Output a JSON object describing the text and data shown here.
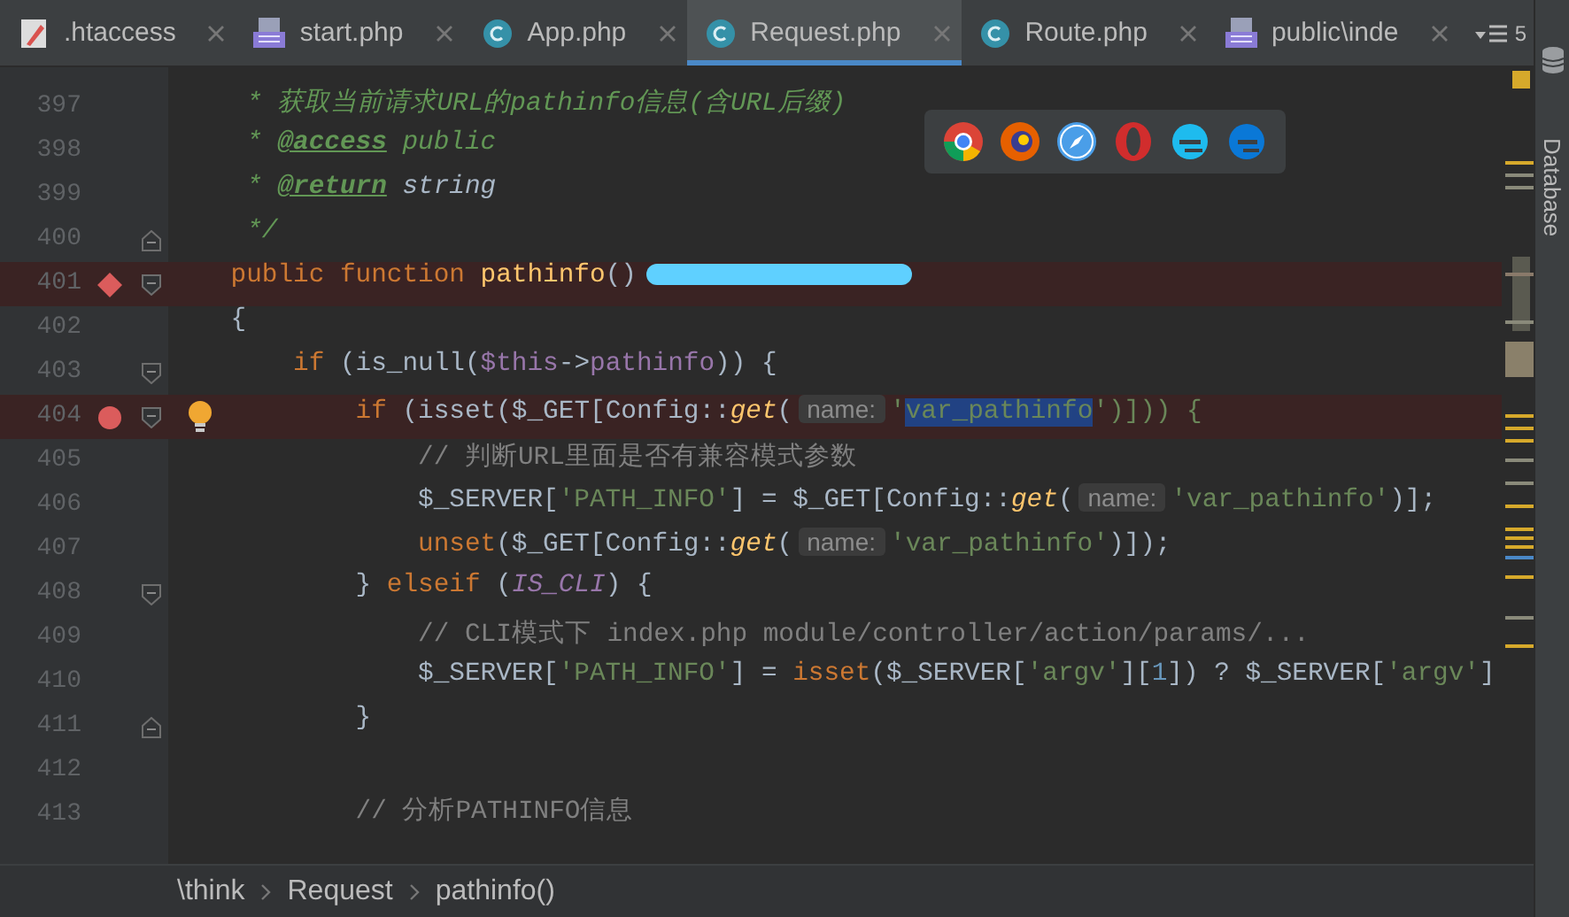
{
  "tabs": [
    {
      "label": ".htaccess",
      "kind": "htaccess",
      "selected": false
    },
    {
      "label": "start.php",
      "kind": "php",
      "selected": false
    },
    {
      "label": "App.php",
      "kind": "class",
      "selected": false
    },
    {
      "label": "Request.php",
      "kind": "class",
      "selected": true
    },
    {
      "label": "Route.php",
      "kind": "class",
      "selected": false
    },
    {
      "label": "public\\inde",
      "kind": "php",
      "selected": false
    }
  ],
  "tab_overflow": {
    "count": "5"
  },
  "side_panel": {
    "label": "Database"
  },
  "lines": [
    {
      "number": "397",
      "tokens": [
        {
          "text": "     * 获取当前请求URL的pathinfo信息(含URL后缀)",
          "kind": "doc"
        }
      ]
    },
    {
      "number": "398",
      "tokens": [
        {
          "text": "     * ",
          "kind": "doc"
        },
        {
          "text": "@access",
          "kind": "doctag"
        },
        {
          "text": " public",
          "kind": "doc"
        }
      ]
    },
    {
      "number": "399",
      "tokens": [
        {
          "text": "     * ",
          "kind": "doc"
        },
        {
          "text": "@return",
          "kind": "doctag"
        },
        {
          "text": " string",
          "kind": "doctype"
        }
      ]
    },
    {
      "number": "400",
      "fold_end": true,
      "tokens": [
        {
          "text": "     */",
          "kind": "doc"
        }
      ]
    },
    {
      "number": "401",
      "method_breakpoint": true,
      "fold_start": true,
      "highlighted": true,
      "redacted": true,
      "tokens": [
        {
          "text": "    public function ",
          "kind": "keyword"
        },
        {
          "text": "pathinfo",
          "kind": "function"
        },
        {
          "text": "()",
          "kind": "plain"
        }
      ]
    },
    {
      "number": "402",
      "tokens": [
        {
          "text": "    {",
          "kind": "plain"
        }
      ]
    },
    {
      "number": "403",
      "fold_start": true,
      "tokens": [
        {
          "text": "        if ",
          "kind": "keyword"
        },
        {
          "text": "(is_null(",
          "kind": "plain"
        },
        {
          "text": "$this",
          "kind": "variable"
        },
        {
          "text": "->",
          "kind": "plain"
        },
        {
          "text": "pathinfo",
          "kind": "variable"
        },
        {
          "text": ")) {",
          "kind": "plain"
        }
      ]
    },
    {
      "number": "404",
      "line_breakpoint": true,
      "fold_start": true,
      "bulb": true,
      "highlighted": true,
      "tokens": [
        {
          "text": "            if ",
          "kind": "keyword"
        },
        {
          "text": "(isset($_GET[Config::",
          "kind": "plain"
        },
        {
          "text": "get",
          "kind": "static"
        },
        {
          "text": "(",
          "kind": "plain"
        },
        {
          "text": "name:",
          "kind": "hint"
        },
        {
          "text": "'",
          "kind": "string"
        },
        {
          "text": "var_pathinfo",
          "kind": "selection"
        },
        {
          "text": "')])) {",
          "kind": "string_tail"
        }
      ]
    },
    {
      "number": "405",
      "tokens": [
        {
          "text": "                // 判断URL里面是否有兼容模式参数",
          "kind": "comment"
        }
      ]
    },
    {
      "number": "406",
      "tokens": [
        {
          "text": "                $_SERVER[",
          "kind": "plain"
        },
        {
          "text": "'PATH_INFO'",
          "kind": "string"
        },
        {
          "text": "] = $_GET[Config::",
          "kind": "plain"
        },
        {
          "text": "get",
          "kind": "static"
        },
        {
          "text": "(",
          "kind": "plain"
        },
        {
          "text": "name:",
          "kind": "hint"
        },
        {
          "text": "'var_pathinfo'",
          "kind": "string"
        },
        {
          "text": ")];",
          "kind": "plain"
        }
      ]
    },
    {
      "number": "407",
      "tokens": [
        {
          "text": "                unset",
          "kind": "keyword"
        },
        {
          "text": "($_GET[Config::",
          "kind": "plain"
        },
        {
          "text": "get",
          "kind": "static"
        },
        {
          "text": "(",
          "kind": "plain"
        },
        {
          "text": "name:",
          "kind": "hint"
        },
        {
          "text": "'var_pathinfo'",
          "kind": "string"
        },
        {
          "text": ")]);",
          "kind": "plain"
        }
      ]
    },
    {
      "number": "408",
      "fold_start": true,
      "tokens": [
        {
          "text": "            } ",
          "kind": "plain"
        },
        {
          "text": "elseif ",
          "kind": "keyword"
        },
        {
          "text": "(",
          "kind": "plain"
        },
        {
          "text": "IS_CLI",
          "kind": "constant"
        },
        {
          "text": ") {",
          "kind": "plain"
        }
      ]
    },
    {
      "number": "409",
      "tokens": [
        {
          "text": "                // CLI模式下 index.php module/controller/action/params/...",
          "kind": "comment"
        }
      ]
    },
    {
      "number": "410",
      "tokens": [
        {
          "text": "                $_SERVER[",
          "kind": "plain"
        },
        {
          "text": "'PATH_INFO'",
          "kind": "string"
        },
        {
          "text": "] = ",
          "kind": "plain"
        },
        {
          "text": "isset",
          "kind": "keyword"
        },
        {
          "text": "($_SERVER[",
          "kind": "plain"
        },
        {
          "text": "'argv'",
          "kind": "string"
        },
        {
          "text": "][",
          "kind": "plain"
        },
        {
          "text": "1",
          "kind": "number"
        },
        {
          "text": "]) ? $_SERVER[",
          "kind": "plain"
        },
        {
          "text": "'argv'",
          "kind": "string"
        },
        {
          "text": "]",
          "kind": "plain"
        }
      ]
    },
    {
      "number": "411",
      "fold_end": true,
      "tokens": [
        {
          "text": "            }",
          "kind": "plain"
        }
      ]
    },
    {
      "number": "412"
    },
    {
      "number": "413",
      "tokens": [
        {
          "text": "            // 分析PATHINFO信息",
          "kind": "comment"
        }
      ]
    }
  ],
  "breadcrumbs": [
    "\\think",
    "Request",
    "pathinfo()"
  ]
}
